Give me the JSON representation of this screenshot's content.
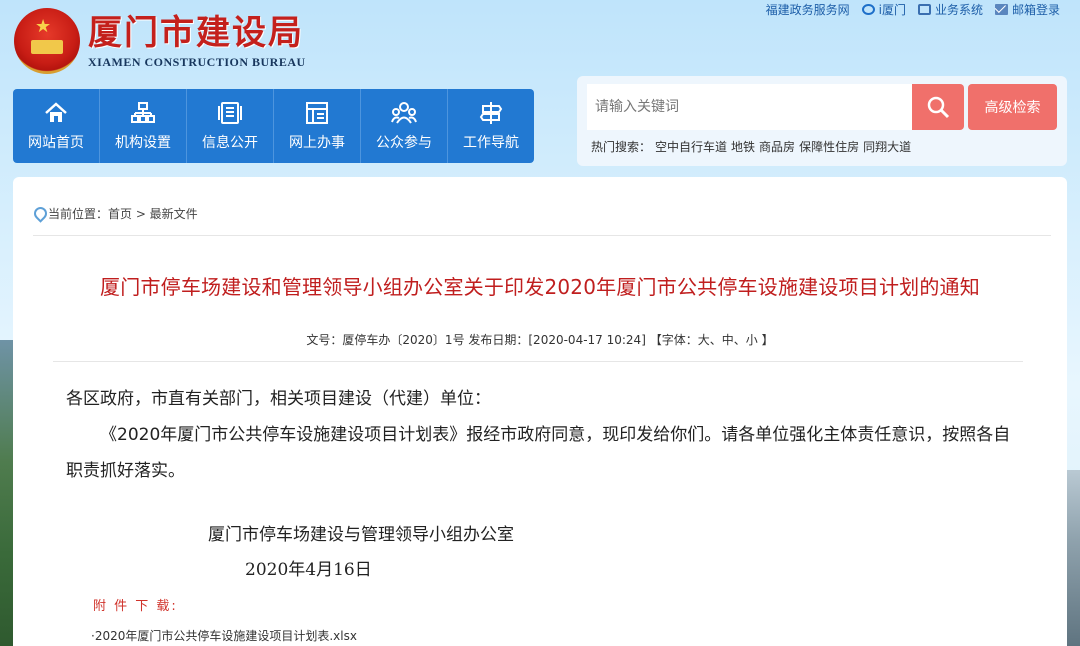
{
  "top_links": {
    "service": "福建政务服务网",
    "ixm": "i厦门",
    "business": "业务系统",
    "mail": "邮箱登录"
  },
  "logo": {
    "cn": "厦门市建设局",
    "en": "XIAMEN CONSTRUCTION BUREAU"
  },
  "nav": {
    "items": [
      {
        "label": "网站首页",
        "icon": "home-icon"
      },
      {
        "label": "机构设置",
        "icon": "org-icon"
      },
      {
        "label": "信息公开",
        "icon": "info-icon"
      },
      {
        "label": "网上办事",
        "icon": "service-icon"
      },
      {
        "label": "公众参与",
        "icon": "people-icon"
      },
      {
        "label": "工作导航",
        "icon": "signpost-icon"
      }
    ]
  },
  "search": {
    "placeholder": "请输入关键词",
    "advanced_label": "高级检索",
    "hot_label": "热门搜索：",
    "hot_items": [
      "空中自行车道",
      "地铁",
      "商品房",
      "保障性住房",
      "同翔大道"
    ]
  },
  "breadcrumb": {
    "text": "当前位置：首页 > 最新文件"
  },
  "document": {
    "title": "厦门市停车场建设和管理领导小组办公室关于印发2020年厦门市公共停车设施建设项目计划的通知",
    "meta_prefix": "文号：厦停车办〔2020〕1号 发布日期：[2020-04-17 10:24] 【字体：",
    "font_large": "大",
    "font_medium": "中",
    "font_small": "小",
    "meta_suffix": " 】",
    "salutation": "各区政府，市直有关部门，相关项目建设（代建）单位：",
    "paragraph": "《2020年厦门市公共停车设施建设项目计划表》报经市政府同意，现印发给你们。请各单位强化主体责任意识，按照各自职责抓好落实。",
    "signature": "厦门市停车场建设与管理领导小组办公室",
    "date": "2020年4月16日",
    "attachment_label": "附 件 下 载:",
    "attachment_file": "·2020年厦门市公共停车设施建设项目计划表.xlsx"
  },
  "colors": {
    "nav_bg": "#2279d2",
    "accent_red": "#f0706b",
    "title_red": "#c01e1e"
  }
}
